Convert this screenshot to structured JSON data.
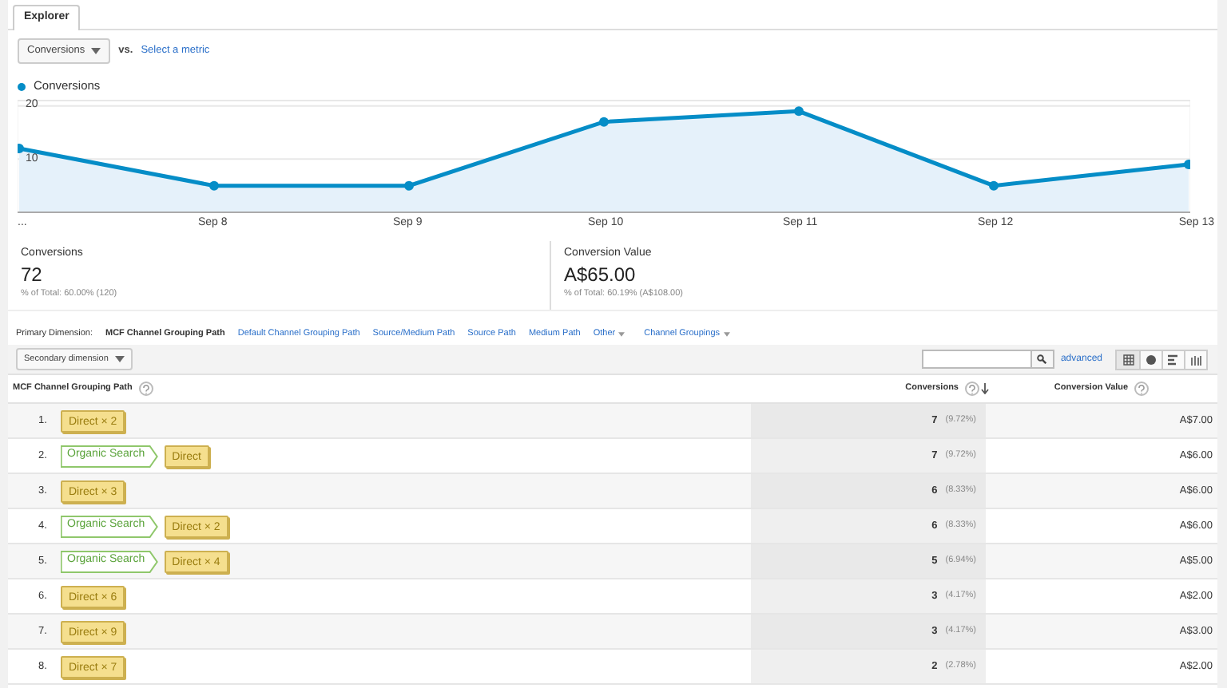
{
  "tabs": [
    {
      "label": "Explorer",
      "selected": true
    }
  ],
  "metric_selector": {
    "value": "Conversions",
    "vs": "vs.",
    "link": "Select a metric"
  },
  "chart": {
    "chart_data": {
      "type": "area",
      "categories": [
        "...",
        "Sep 8",
        "Sep 9",
        "Sep 10",
        "Sep 11",
        "Sep 12",
        "Sep 13"
      ],
      "series": [
        {
          "name": "Conversions",
          "color": "#058dc7",
          "values": [
            12,
            5,
            5,
            17,
            19,
            5,
            9
          ]
        }
      ],
      "ylim": [
        0,
        21
      ],
      "yticks": [
        10,
        20
      ]
    }
  },
  "scorecards": [
    {
      "label": "Conversions",
      "value": "72",
      "note": "% of Total: 60.00% (120)"
    },
    {
      "label": "Conversion Value",
      "value": "A$65.00",
      "note": "% of Total: 60.19% (A$108.00)"
    }
  ],
  "primary_dimension": {
    "label": "Primary Dimension:",
    "options": [
      {
        "label": "MCF Channel Grouping Path",
        "selected": true
      },
      {
        "label": "Default Channel Grouping Path",
        "selected": false
      },
      {
        "label": "Source/Medium Path",
        "selected": false
      },
      {
        "label": "Source Path",
        "selected": false
      },
      {
        "label": "Medium Path",
        "selected": false
      },
      {
        "label": "Other",
        "selected": false,
        "dropdown": true
      },
      {
        "label": "Channel Groupings",
        "selected": false,
        "dropdown": true
      }
    ]
  },
  "toolbar": {
    "secondary_dimension": "Secondary dimension",
    "advanced": "advanced"
  },
  "table": {
    "columns": [
      "MCF Channel Grouping Path",
      "Conversions",
      "Conversion Value"
    ],
    "rows": [
      {
        "index": "1.",
        "path": [
          {
            "kind": "direct",
            "label": "Direct × 2"
          }
        ],
        "conversions": "7",
        "share": "(9.72%)",
        "value": "A$7.00"
      },
      {
        "index": "2.",
        "path": [
          {
            "kind": "organic",
            "label": "Organic Search"
          },
          {
            "kind": "direct",
            "label": "Direct"
          }
        ],
        "conversions": "7",
        "share": "(9.72%)",
        "value": "A$6.00"
      },
      {
        "index": "3.",
        "path": [
          {
            "kind": "direct",
            "label": "Direct × 3"
          }
        ],
        "conversions": "6",
        "share": "(8.33%)",
        "value": "A$6.00"
      },
      {
        "index": "4.",
        "path": [
          {
            "kind": "organic",
            "label": "Organic Search"
          },
          {
            "kind": "direct",
            "label": "Direct × 2"
          }
        ],
        "conversions": "6",
        "share": "(8.33%)",
        "value": "A$6.00"
      },
      {
        "index": "5.",
        "path": [
          {
            "kind": "organic",
            "label": "Organic Search"
          },
          {
            "kind": "direct",
            "label": "Direct × 4"
          }
        ],
        "conversions": "5",
        "share": "(6.94%)",
        "value": "A$5.00"
      },
      {
        "index": "6.",
        "path": [
          {
            "kind": "direct",
            "label": "Direct × 6"
          }
        ],
        "conversions": "3",
        "share": "(4.17%)",
        "value": "A$2.00"
      },
      {
        "index": "7.",
        "path": [
          {
            "kind": "direct",
            "label": "Direct × 9"
          }
        ],
        "conversions": "3",
        "share": "(4.17%)",
        "value": "A$3.00"
      },
      {
        "index": "8.",
        "path": [
          {
            "kind": "direct",
            "label": "Direct × 7"
          }
        ],
        "conversions": "2",
        "share": "(2.78%)",
        "value": "A$2.00"
      }
    ]
  }
}
